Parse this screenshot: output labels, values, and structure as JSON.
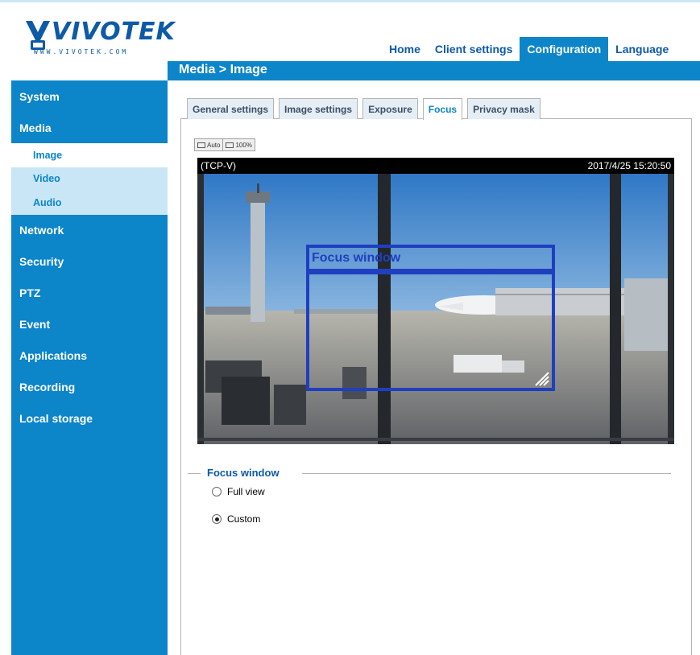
{
  "brand": {
    "name": "VIVOTEK",
    "url": "WWW.VIVOTEK.COM"
  },
  "topnav": [
    {
      "label": "Home",
      "active": false
    },
    {
      "label": "Client settings",
      "active": false
    },
    {
      "label": "Configuration",
      "active": true
    },
    {
      "label": "Language",
      "active": false
    }
  ],
  "breadcrumb": "Media > Image",
  "sidebar": {
    "items": [
      {
        "label": "System"
      },
      {
        "label": "Media"
      },
      {
        "label": "Network"
      },
      {
        "label": "Security"
      },
      {
        "label": "PTZ"
      },
      {
        "label": "Event"
      },
      {
        "label": "Applications"
      },
      {
        "label": "Recording"
      },
      {
        "label": "Local storage"
      }
    ],
    "media_subitems": [
      {
        "label": "Image",
        "selected": true
      },
      {
        "label": "Video",
        "selected": false
      },
      {
        "label": "Audio",
        "selected": false
      }
    ]
  },
  "tabs": [
    {
      "label": "General settings",
      "active": false
    },
    {
      "label": "Image settings",
      "active": false
    },
    {
      "label": "Exposure",
      "active": false
    },
    {
      "label": "Focus",
      "active": true
    },
    {
      "label": "Privacy mask",
      "active": false
    }
  ],
  "zoom": {
    "auto_label": "Auto",
    "full_label": "100%"
  },
  "video": {
    "stream_label": "(TCP-V)",
    "timestamp": "2017/4/25 15:20:50",
    "focus_window_label": "Focus window"
  },
  "focus_window": {
    "legend": "Focus window",
    "options": [
      {
        "label": "Full view",
        "checked": false
      },
      {
        "label": "Custom",
        "checked": true
      }
    ]
  },
  "colors": {
    "accent": "#0c85c9",
    "sub_menu_bg": "#c9e6f6",
    "focus_window": "#1f3fc0"
  }
}
